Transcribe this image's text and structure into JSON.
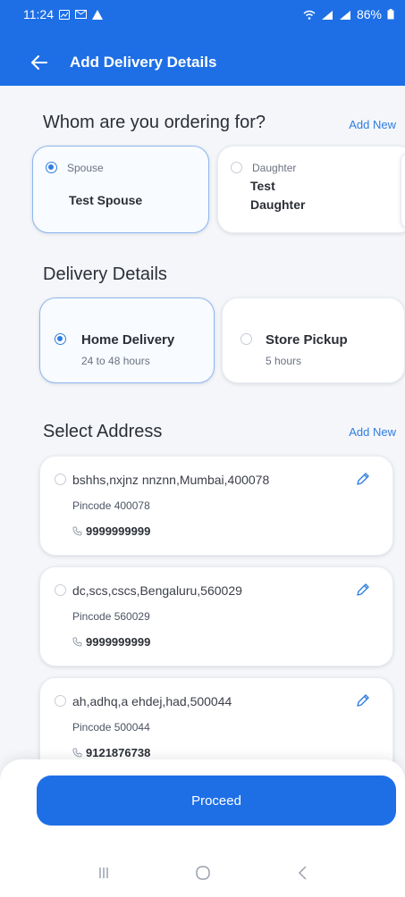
{
  "status_bar": {
    "time": "11:24",
    "battery": "86%"
  },
  "header": {
    "title": "Add Delivery Details"
  },
  "ordering_for": {
    "title": "Whom are you ordering for?",
    "add_new": "Add New",
    "options": [
      {
        "relation": "Spouse",
        "name": "Test Spouse",
        "selected": true
      },
      {
        "relation": "Daughter",
        "name_line1": "Test",
        "name_line2": "Daughter",
        "selected": false
      }
    ]
  },
  "delivery": {
    "title": "Delivery Details",
    "options": [
      {
        "label": "Home Delivery",
        "sub": "24 to 48 hours",
        "selected": true
      },
      {
        "label": "Store Pickup",
        "sub": "5 hours",
        "selected": false
      }
    ]
  },
  "address": {
    "title": "Select Address",
    "add_new": "Add New",
    "items": [
      {
        "line": "bshhs,nxjnz nnznn,Mumbai,400078",
        "pincode": "Pincode 400078",
        "phone": "9999999999"
      },
      {
        "line": "dc,scs,cscs,Bengaluru,560029",
        "pincode": "Pincode 560029",
        "phone": "9999999999"
      },
      {
        "line": "ah,adhq,a ehdej,had,500044",
        "pincode": "Pincode 500044",
        "phone": "9121876738"
      }
    ]
  },
  "footer": {
    "proceed_label": "Proceed"
  },
  "colors": {
    "primary": "#1e6fe6",
    "accent": "#2f7de1",
    "background": "#f4f6fa"
  }
}
